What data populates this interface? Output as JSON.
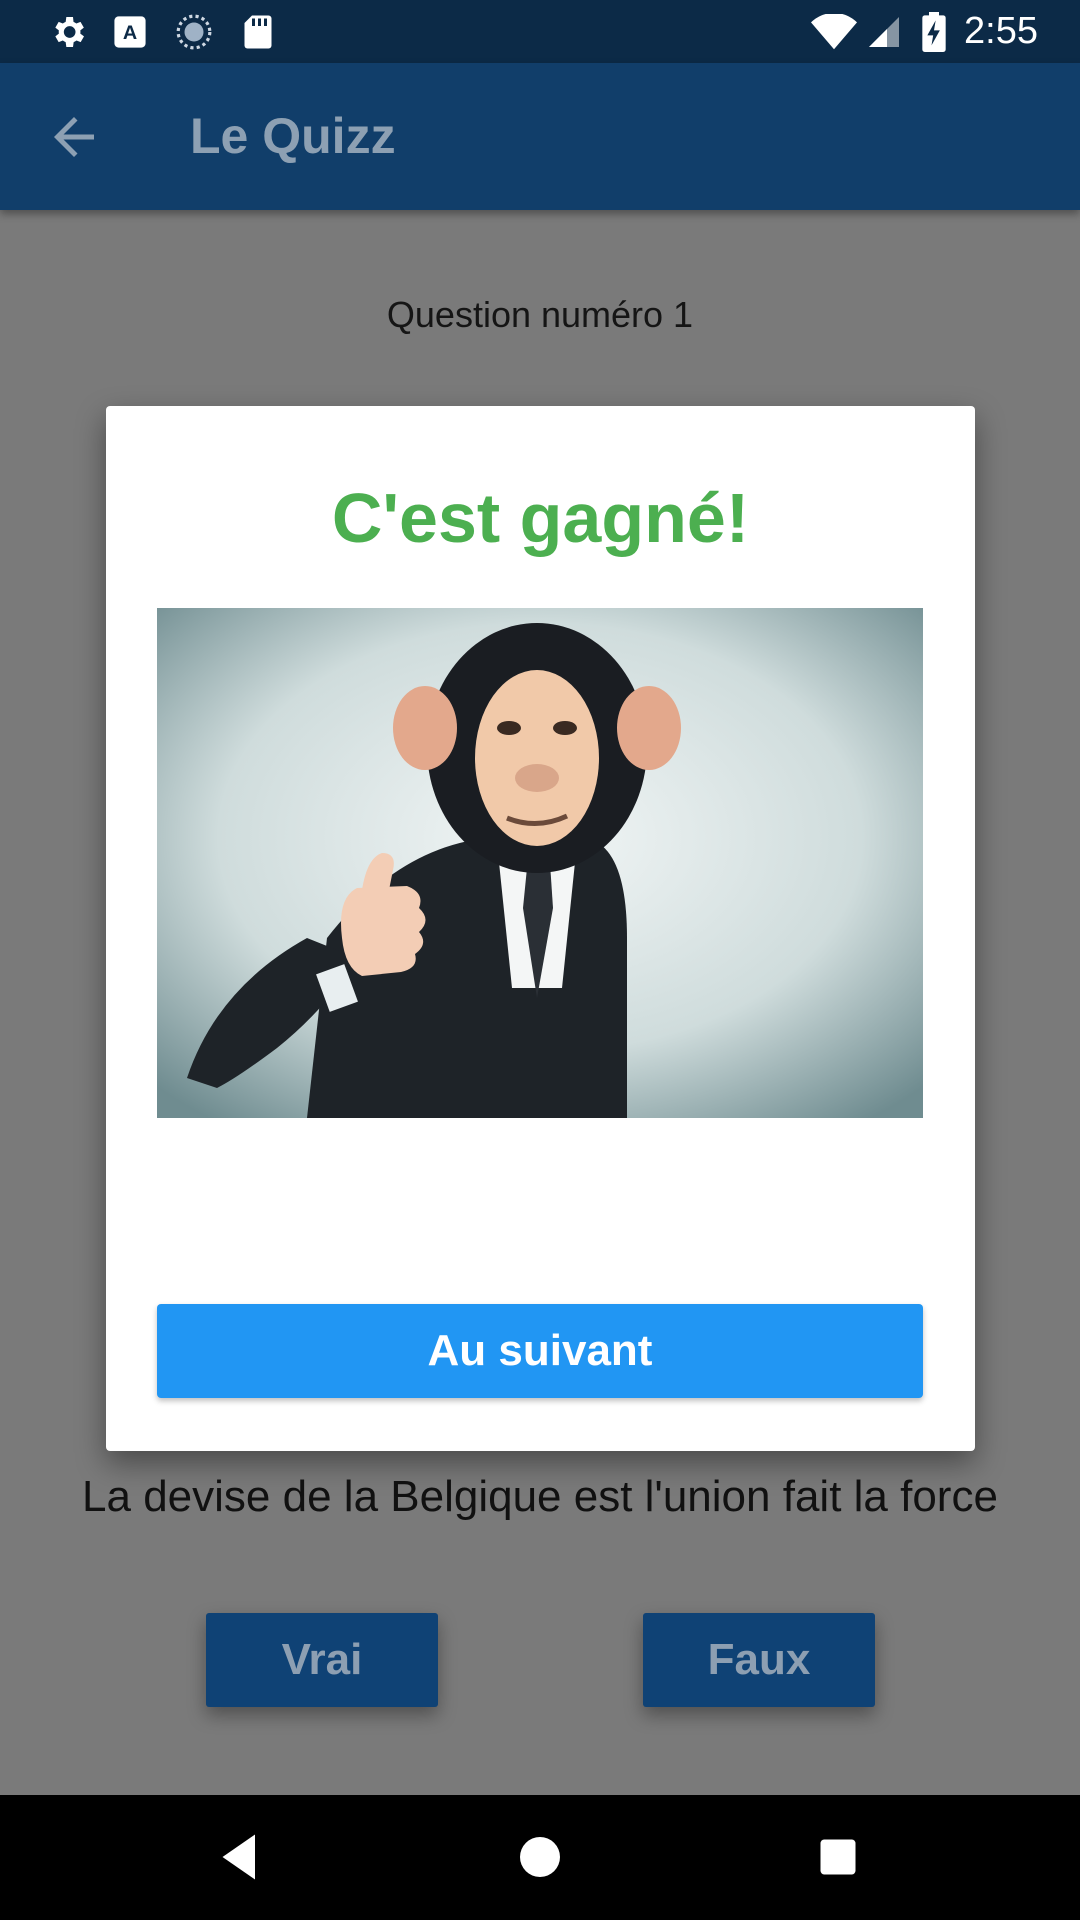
{
  "status_bar": {
    "time": "2:55",
    "icons": [
      "gear-icon",
      "font-a-icon",
      "sync-circle-icon",
      "sd-card-icon",
      "wifi-icon",
      "signal-icon",
      "battery-charging-icon"
    ]
  },
  "app_bar": {
    "title": "Le Quizz",
    "back_icon": "arrow-left-icon"
  },
  "content": {
    "question_number": "Question numéro 1",
    "question_text": "La devise de la Belgique est l'union fait la force",
    "true_label": "Vrai",
    "false_label": "Faux"
  },
  "dialog": {
    "title": "C'est gagné!",
    "image": "monkey-mask-thumbs-up-photo",
    "button_label": "Au suivant"
  },
  "nav_bar": {
    "icons": [
      "back-triangle-icon",
      "home-circle-icon",
      "recents-square-icon"
    ]
  },
  "colors": {
    "status_bar": "#0c2a47",
    "app_bar": "#113e6a",
    "scrim_background": "#7a7a7a",
    "success_green": "#4caf50",
    "primary_blue": "#2196f3"
  }
}
